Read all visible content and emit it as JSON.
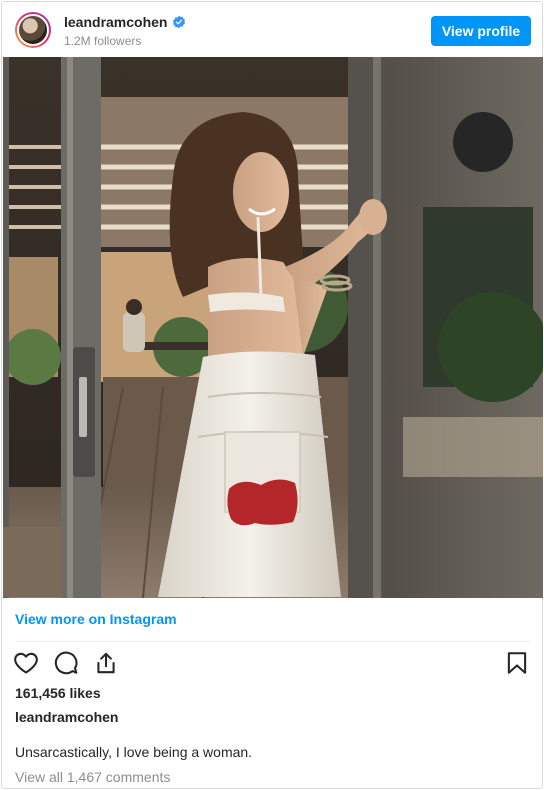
{
  "header": {
    "username": "leandramcohen",
    "followers": "1.2M followers",
    "view_profile_label": "View profile",
    "verified_icon": "verified-badge-icon",
    "accent_color": "#0095f6"
  },
  "post": {
    "view_more_label": "View more on Instagram",
    "likes": "161,456 likes",
    "caption_user": "leandramcohen",
    "caption": "Unsarcastically, I love being a woman.",
    "comments_link": "View all 1,467 comments"
  },
  "icons": [
    "heart-icon",
    "comment-icon",
    "share-icon",
    "bookmark-icon"
  ]
}
